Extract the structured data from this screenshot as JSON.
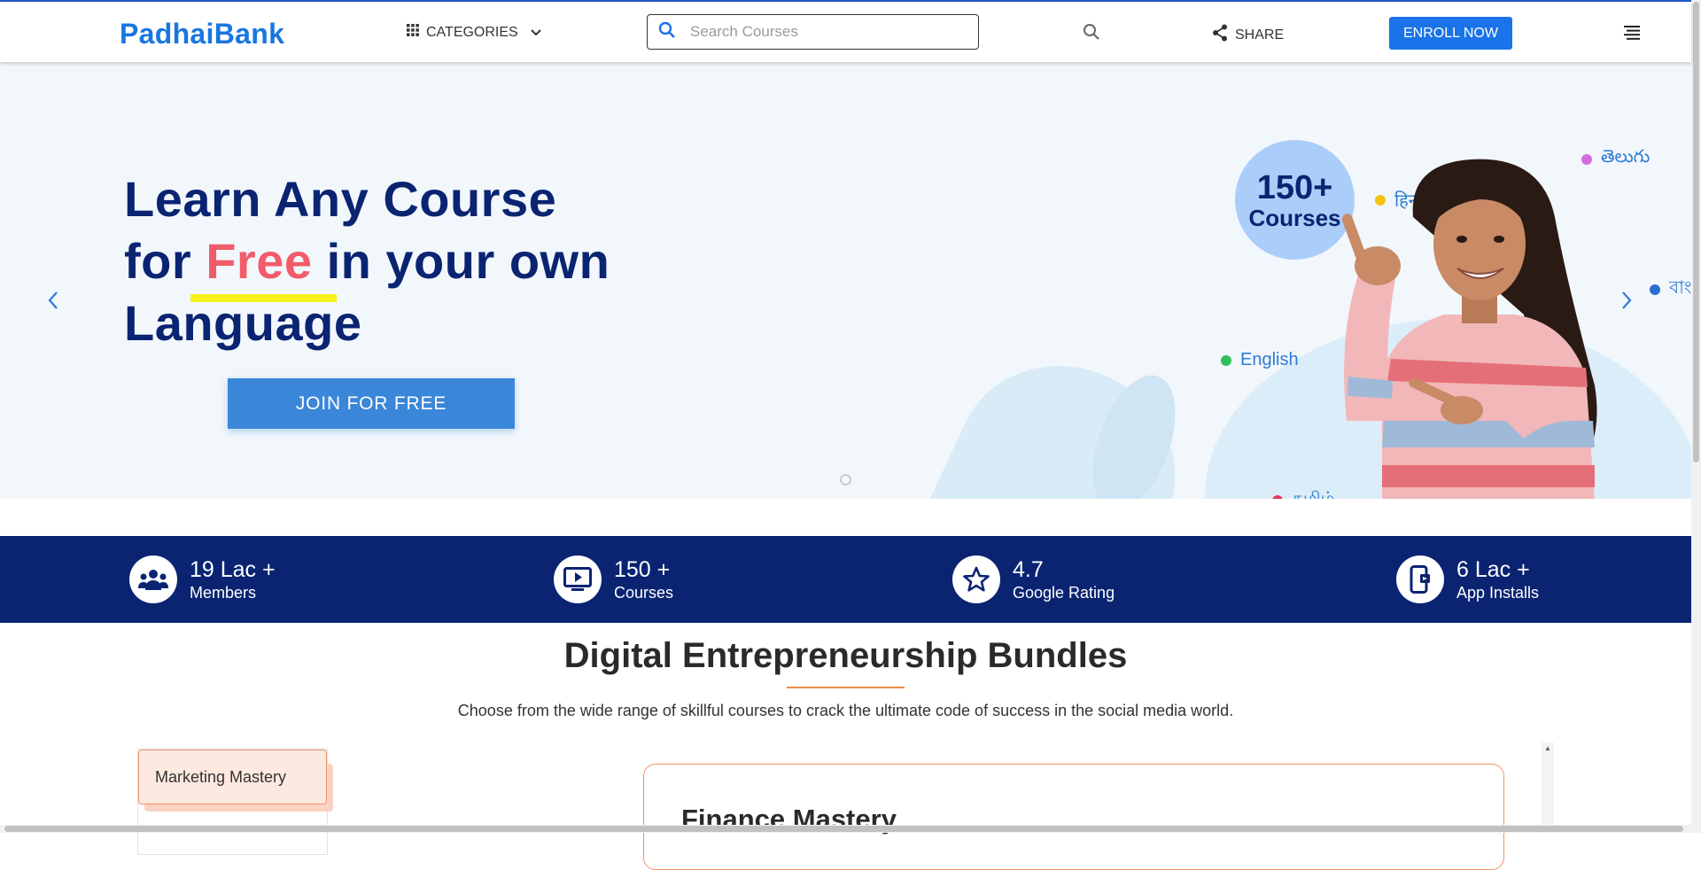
{
  "header": {
    "logo": "PadhaiBank",
    "categories_label": "CATEGORIES",
    "search_placeholder": "Search Courses",
    "share_label": "SHARE",
    "enroll_label": "ENROLL NOW"
  },
  "hero": {
    "title_line1": "Learn Any Course",
    "title_for": "for",
    "title_free": "Free",
    "title_rest": "in your own",
    "title_line3": "Language",
    "cta_label": "JOIN FOR FREE",
    "badge_number": "150+",
    "badge_label": "Courses",
    "languages": [
      {
        "label": "తెలుగు",
        "color": "#d36de0"
      },
      {
        "label": "हिन्दी",
        "color": "#f5c211"
      },
      {
        "label": "বাং",
        "color": "#2b6fd0"
      },
      {
        "label": "English",
        "color": "#2fbf5b"
      },
      {
        "label": "தமிழ்",
        "color": "#e53950"
      }
    ]
  },
  "stats": [
    {
      "value": "19 Lac +",
      "caption": "Members",
      "icon": "group-icon"
    },
    {
      "value": "150 +",
      "caption": "Courses",
      "icon": "video-play-icon"
    },
    {
      "value": "4.7",
      "caption": "Google Rating",
      "icon": "star-icon"
    },
    {
      "value": "6 Lac +",
      "caption": "App Installs",
      "icon": "mobile-app-icon"
    }
  ],
  "bundles": {
    "title": "Digital Entrepreneurship Bundles",
    "subtitle": "Choose from the wide range of skillful courses to crack the ultimate code of success in the social media world.",
    "tab_active": "Marketing Mastery",
    "card_title": "Finance Mastery"
  },
  "colors": {
    "brand_blue": "#1976e0",
    "navy": "#0a2472",
    "accent_red": "#f25c6a",
    "cta_blue": "#3a86d9",
    "orange": "#f08a4b"
  }
}
